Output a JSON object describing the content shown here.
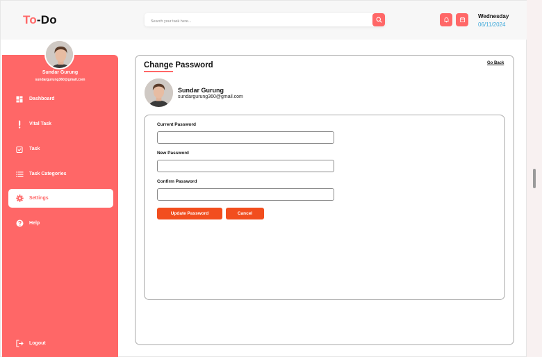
{
  "app": {
    "logo_prefix": "To",
    "logo_suffix": "-Do"
  },
  "header": {
    "search_placeholder": "Search your task here...",
    "day": "Wednesday",
    "date": "06/11/2024"
  },
  "sidebar": {
    "user_name": "Sundar Gurung",
    "user_email": "sundargurung360@gmail.com",
    "items": [
      {
        "label": "Dashboard",
        "icon": "dashboard-icon"
      },
      {
        "label": "Vital Task",
        "icon": "exclamation-icon"
      },
      {
        "label": "Task",
        "icon": "task-check-icon"
      },
      {
        "label": "Task Categories",
        "icon": "list-icon"
      },
      {
        "label": "Settings",
        "icon": "gear-icon",
        "active": true
      },
      {
        "label": "Help",
        "icon": "help-icon"
      }
    ],
    "logout_label": "Logout"
  },
  "main": {
    "title": "Change Password",
    "go_back": "Go Back",
    "profile_name": "Sundar Gurung",
    "profile_email": "sundargurung360@gmail.com",
    "form": {
      "current_label": "Current Password",
      "current_value": "",
      "new_label": "New Password",
      "new_value": "",
      "confirm_label": "Confirm Password",
      "confirm_value": "",
      "update_button": "Update Password",
      "cancel_button": "Cancel"
    }
  },
  "colors": {
    "accent": "#ff6767",
    "button": "#f24e1e",
    "date": "#3aa6d9"
  }
}
